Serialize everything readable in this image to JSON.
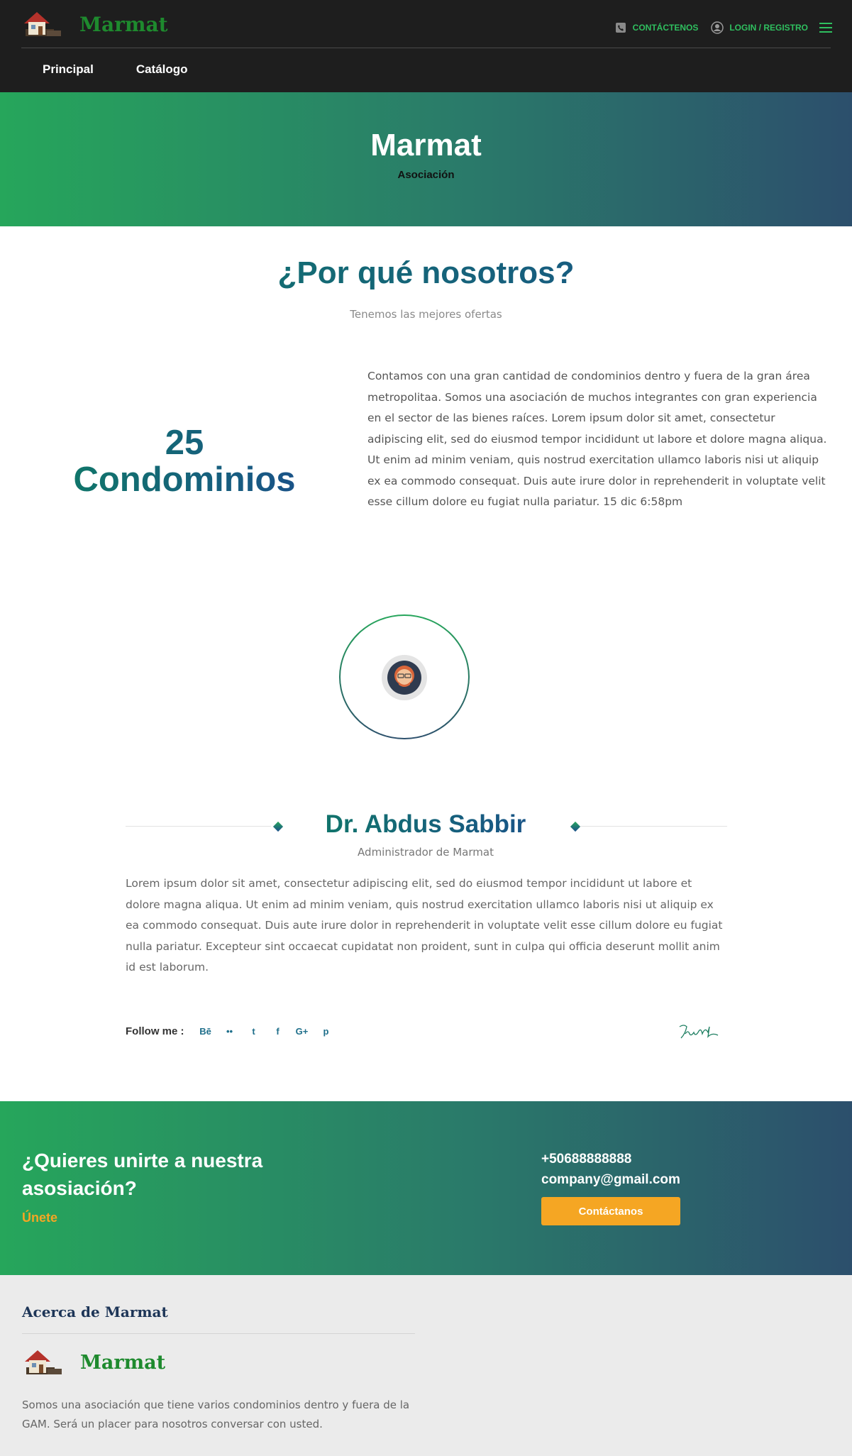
{
  "header": {
    "brand_name": "Marmat",
    "contact_label": "CONTÁCTENOS",
    "login_label": "LOGIN / REGISTRO",
    "nav": [
      {
        "label": "Principal"
      },
      {
        "label": "Catálogo"
      }
    ],
    "icons": {
      "logo": "house-icon",
      "phone": "phone-icon",
      "user": "user-icon",
      "menu": "menu-icon"
    },
    "accent_color": "#2fbf5f"
  },
  "hero": {
    "title": "Marmat",
    "subtitle": "Asociación",
    "gradient": [
      "#26a65b",
      "#2c4f6c"
    ]
  },
  "why": {
    "title": "¿Por qué nosotros?",
    "subtitle": "Tenemos las mejores ofertas",
    "stat_number": "25",
    "stat_label": "Condominios",
    "text": "Contamos con una gran cantidad de condominios dentro y fuera de la gran área metropolitaa. Somos una asociación de muchos integrantes con gran experiencia en el sector de las bienes raíces. Lorem ipsum dolor sit amet, consectetur adipiscing elit, sed do eiusmod tempor incididunt ut labore et dolore magna aliqua. Ut enim ad minim veniam, quis nostrud exercitation ullamco laboris nisi ut aliquip ex ea commodo consequat. Duis aute irure dolor in reprehenderit in voluptate velit esse cillum dolore eu fugiat nulla pariatur. 15 dic 6:58pm"
  },
  "person": {
    "name": "Dr. Abdus Sabbir",
    "role": "Administrador de Marmat",
    "bio": "Lorem ipsum dolor sit amet, consectetur adipiscing elit, sed do eiusmod tempor incididunt ut labore et dolore magna aliqua. Ut enim ad minim veniam, quis nostrud exercitation ullamco laboris nisi ut aliquip ex ea commodo consequat. Duis aute irure dolor in reprehenderit in voluptate velit esse cillum dolore eu fugiat nulla pariatur. Excepteur sint occaecat cupidatat non proident, sunt in culpa qui officia deserunt mollit anim id est laborum.",
    "follow_label": "Follow me :",
    "social": [
      {
        "label": "Bē",
        "icon": "behance-icon"
      },
      {
        "label": "••",
        "icon": "flickr-icon"
      },
      {
        "label": "t",
        "icon": "twitter-icon"
      },
      {
        "label": "f",
        "icon": "facebook-icon"
      },
      {
        "label": "G+",
        "icon": "google-plus-icon"
      },
      {
        "label": "p",
        "icon": "pinterest-icon"
      }
    ],
    "avatar_icon": "avatar-icon",
    "signature_icon": "signature-icon"
  },
  "cta": {
    "title": "¿Quieres unirte a nuestra asosiación?",
    "join_label": "Únete",
    "phone": "+50688888888",
    "email": "company@gmail.com",
    "button_label": "Contáctanos",
    "button_color": "#f5a623"
  },
  "footer": {
    "heading": "Acerca de Marmat",
    "brand_name": "Marmat",
    "text": "Somos una asociación que tiene varios condominios dentro y fuera de la GAM. Será un placer para nosotros conversar con usted."
  }
}
